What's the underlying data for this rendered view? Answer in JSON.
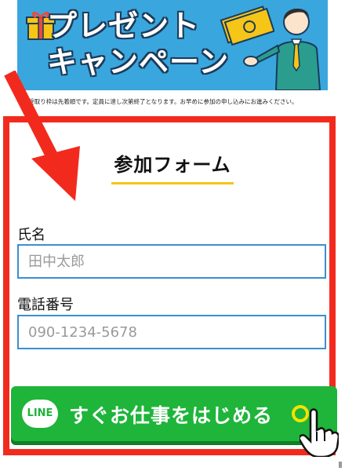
{
  "banner": {
    "title_line1": "プレゼント",
    "title_line2": "キャンペーン"
  },
  "notice": "※受取り枠は先着順です。定員に達し次第終了となります。お早めに参加の申し込みにお進みください。",
  "form": {
    "title": "参加フォーム",
    "name_label": "氏名",
    "name_placeholder": "田中太郎",
    "phone_label": "電話番号",
    "phone_placeholder": "090-1234-5678"
  },
  "cta": {
    "badge": "LINE",
    "label": "すぐお仕事をはじめる"
  },
  "colors": {
    "banner_blue": "#3aa6de",
    "frame_red": "#f22a1e",
    "accent_yellow": "#f5c518",
    "input_border": "#3b8fd0",
    "cta_green": "#1eb53a"
  },
  "icons": [
    "gift-icon",
    "money-icon",
    "man-illustration",
    "arrow-icon",
    "line-icon",
    "hand-pointer-icon"
  ]
}
